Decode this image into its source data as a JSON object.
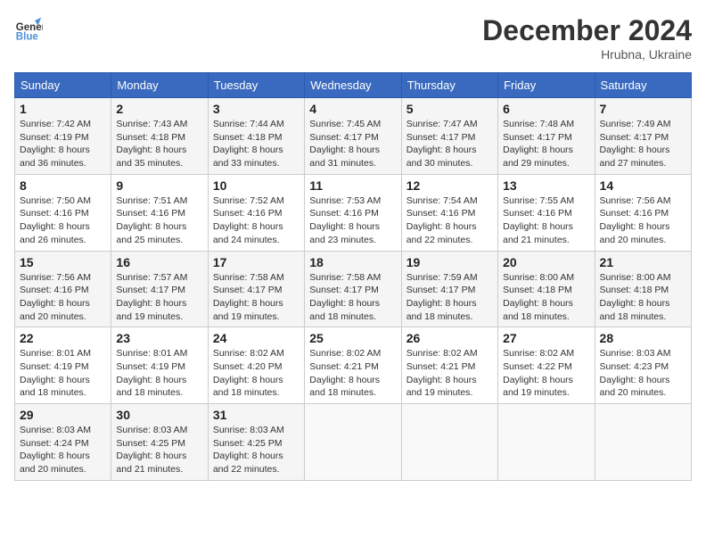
{
  "header": {
    "logo_line1": "General",
    "logo_line2": "Blue",
    "month": "December 2024",
    "location": "Hrubna, Ukraine"
  },
  "weekdays": [
    "Sunday",
    "Monday",
    "Tuesday",
    "Wednesday",
    "Thursday",
    "Friday",
    "Saturday"
  ],
  "weeks": [
    [
      {
        "day": "1",
        "sunrise": "7:42 AM",
        "sunset": "4:19 PM",
        "daylight": "8 hours and 36 minutes."
      },
      {
        "day": "2",
        "sunrise": "7:43 AM",
        "sunset": "4:18 PM",
        "daylight": "8 hours and 35 minutes."
      },
      {
        "day": "3",
        "sunrise": "7:44 AM",
        "sunset": "4:18 PM",
        "daylight": "8 hours and 33 minutes."
      },
      {
        "day": "4",
        "sunrise": "7:45 AM",
        "sunset": "4:17 PM",
        "daylight": "8 hours and 31 minutes."
      },
      {
        "day": "5",
        "sunrise": "7:47 AM",
        "sunset": "4:17 PM",
        "daylight": "8 hours and 30 minutes."
      },
      {
        "day": "6",
        "sunrise": "7:48 AM",
        "sunset": "4:17 PM",
        "daylight": "8 hours and 29 minutes."
      },
      {
        "day": "7",
        "sunrise": "7:49 AM",
        "sunset": "4:17 PM",
        "daylight": "8 hours and 27 minutes."
      }
    ],
    [
      {
        "day": "8",
        "sunrise": "7:50 AM",
        "sunset": "4:16 PM",
        "daylight": "8 hours and 26 minutes."
      },
      {
        "day": "9",
        "sunrise": "7:51 AM",
        "sunset": "4:16 PM",
        "daylight": "8 hours and 25 minutes."
      },
      {
        "day": "10",
        "sunrise": "7:52 AM",
        "sunset": "4:16 PM",
        "daylight": "8 hours and 24 minutes."
      },
      {
        "day": "11",
        "sunrise": "7:53 AM",
        "sunset": "4:16 PM",
        "daylight": "8 hours and 23 minutes."
      },
      {
        "day": "12",
        "sunrise": "7:54 AM",
        "sunset": "4:16 PM",
        "daylight": "8 hours and 22 minutes."
      },
      {
        "day": "13",
        "sunrise": "7:55 AM",
        "sunset": "4:16 PM",
        "daylight": "8 hours and 21 minutes."
      },
      {
        "day": "14",
        "sunrise": "7:56 AM",
        "sunset": "4:16 PM",
        "daylight": "8 hours and 20 minutes."
      }
    ],
    [
      {
        "day": "15",
        "sunrise": "7:56 AM",
        "sunset": "4:16 PM",
        "daylight": "8 hours and 20 minutes."
      },
      {
        "day": "16",
        "sunrise": "7:57 AM",
        "sunset": "4:17 PM",
        "daylight": "8 hours and 19 minutes."
      },
      {
        "day": "17",
        "sunrise": "7:58 AM",
        "sunset": "4:17 PM",
        "daylight": "8 hours and 19 minutes."
      },
      {
        "day": "18",
        "sunrise": "7:58 AM",
        "sunset": "4:17 PM",
        "daylight": "8 hours and 18 minutes."
      },
      {
        "day": "19",
        "sunrise": "7:59 AM",
        "sunset": "4:17 PM",
        "daylight": "8 hours and 18 minutes."
      },
      {
        "day": "20",
        "sunrise": "8:00 AM",
        "sunset": "4:18 PM",
        "daylight": "8 hours and 18 minutes."
      },
      {
        "day": "21",
        "sunrise": "8:00 AM",
        "sunset": "4:18 PM",
        "daylight": "8 hours and 18 minutes."
      }
    ],
    [
      {
        "day": "22",
        "sunrise": "8:01 AM",
        "sunset": "4:19 PM",
        "daylight": "8 hours and 18 minutes."
      },
      {
        "day": "23",
        "sunrise": "8:01 AM",
        "sunset": "4:19 PM",
        "daylight": "8 hours and 18 minutes."
      },
      {
        "day": "24",
        "sunrise": "8:02 AM",
        "sunset": "4:20 PM",
        "daylight": "8 hours and 18 minutes."
      },
      {
        "day": "25",
        "sunrise": "8:02 AM",
        "sunset": "4:21 PM",
        "daylight": "8 hours and 18 minutes."
      },
      {
        "day": "26",
        "sunrise": "8:02 AM",
        "sunset": "4:21 PM",
        "daylight": "8 hours and 19 minutes."
      },
      {
        "day": "27",
        "sunrise": "8:02 AM",
        "sunset": "4:22 PM",
        "daylight": "8 hours and 19 minutes."
      },
      {
        "day": "28",
        "sunrise": "8:03 AM",
        "sunset": "4:23 PM",
        "daylight": "8 hours and 20 minutes."
      }
    ],
    [
      {
        "day": "29",
        "sunrise": "8:03 AM",
        "sunset": "4:24 PM",
        "daylight": "8 hours and 20 minutes."
      },
      {
        "day": "30",
        "sunrise": "8:03 AM",
        "sunset": "4:25 PM",
        "daylight": "8 hours and 21 minutes."
      },
      {
        "day": "31",
        "sunrise": "8:03 AM",
        "sunset": "4:25 PM",
        "daylight": "8 hours and 22 minutes."
      },
      null,
      null,
      null,
      null
    ]
  ]
}
